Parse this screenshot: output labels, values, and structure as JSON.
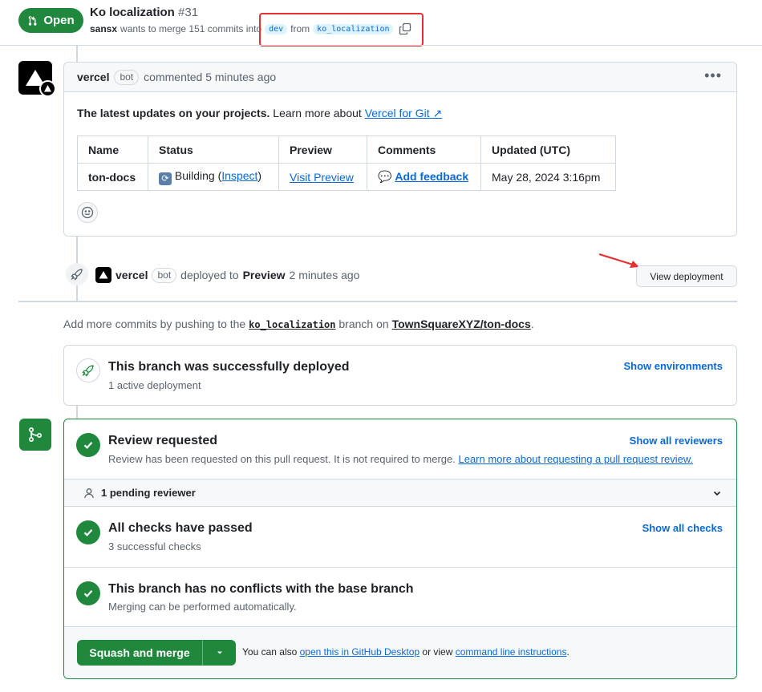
{
  "header": {
    "state": "Open",
    "title": "Ko localization",
    "number": "#31",
    "author": "sansx",
    "merge_text": "wants to merge 151 commits into",
    "base_branch": "dev",
    "from_text": "from",
    "head_branch": "ko_localization"
  },
  "comment": {
    "author": "vercel",
    "bot_label": "bot",
    "action": "commented 5 minutes ago",
    "intro_bold": "The latest updates on your projects.",
    "intro_text": "Learn more about",
    "intro_link": "Vercel for Git ↗",
    "table": {
      "headers": [
        "Name",
        "Status",
        "Preview",
        "Comments",
        "Updated (UTC)"
      ],
      "row": {
        "name": "ton-docs",
        "status": "Building (",
        "status_link": "Inspect",
        "status_close": ")",
        "preview": "Visit Preview",
        "comments": "Add feedback",
        "updated": "May 28, 2024 3:16pm"
      }
    }
  },
  "deploy_event": {
    "actor": "vercel",
    "bot_label": "bot",
    "text": "deployed to",
    "environment": "Preview",
    "time": "2 minutes ago",
    "button": "View deployment"
  },
  "push_hint": {
    "prefix": "Add more commits by pushing to the",
    "branch": "ko_localization",
    "middle": "branch on",
    "repo": "TownSquareXYZ/ton-docs",
    "suffix": "."
  },
  "deployed": {
    "title": "This branch was successfully deployed",
    "subtitle": "1 active deployment",
    "link": "Show environments"
  },
  "merge": {
    "review": {
      "title": "Review requested",
      "subtitle": "Review has been requested on this pull request. It is not required to merge.",
      "subtitle_link": "Learn more about requesting a pull request review.",
      "link": "Show all reviewers"
    },
    "pending": "1 pending reviewer",
    "checks": {
      "title": "All checks have passed",
      "subtitle": "3 successful checks",
      "link": "Show all checks"
    },
    "conflicts": {
      "title": "This branch has no conflicts with the base branch",
      "subtitle": "Merging can be performed automatically."
    },
    "footer": {
      "button": "Squash and merge",
      "text1": "You can also",
      "link1": "open this in GitHub Desktop",
      "text2": "or view",
      "link2": "command line instructions",
      "text3": "."
    }
  },
  "colors": {
    "accent": "#0969da",
    "success": "#1f883d",
    "annotation": "#e5312f"
  }
}
